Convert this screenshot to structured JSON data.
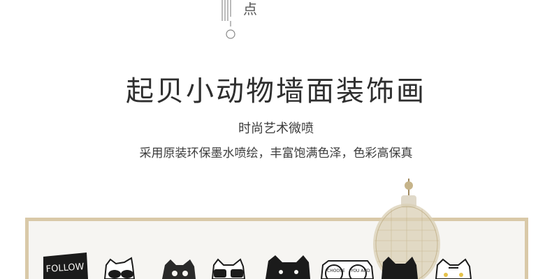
{
  "header": {
    "top_char": "点"
  },
  "hero": {
    "title": "起贝小动物墙面装饰画",
    "subtitle": "时尚艺术微喷",
    "description": "采用原装环保墨水喷绘，丰富饱满色泽，色彩高保真"
  },
  "photo": {
    "sign_text": "FOLLOW",
    "glasses_text_left": "CHOOSE",
    "glasses_text_right": "YOU AND"
  },
  "colors": {
    "frame": "#d9c9a8",
    "canvas": "#f6f5f2",
    "ink": "#1b1b1b"
  }
}
